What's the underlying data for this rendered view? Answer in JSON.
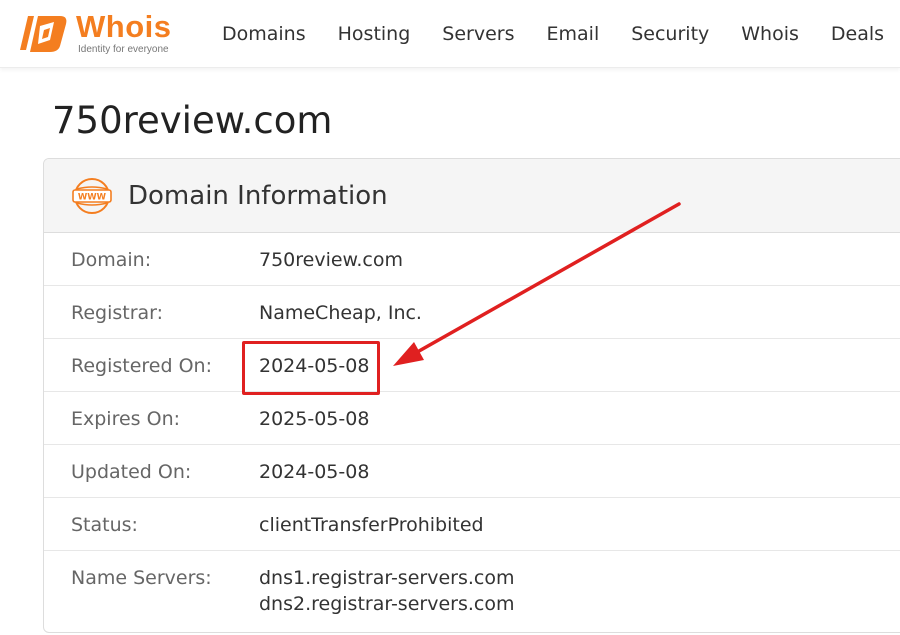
{
  "brand": {
    "name": "Whois",
    "tagline": "Identity for everyone",
    "accent_color": "#f47e20"
  },
  "nav": {
    "items": [
      {
        "label": "Domains"
      },
      {
        "label": "Hosting"
      },
      {
        "label": "Servers"
      },
      {
        "label": "Email"
      },
      {
        "label": "Security"
      },
      {
        "label": "Whois"
      },
      {
        "label": "Deals"
      }
    ]
  },
  "page": {
    "title": "750review.com"
  },
  "domain_info": {
    "icon": "www-globe-icon",
    "icon_text": "WWW",
    "title": "Domain Information",
    "rows": [
      {
        "label": "Domain:",
        "value": "750review.com"
      },
      {
        "label": "Registrar:",
        "value": "NameCheap, Inc."
      },
      {
        "label": "Registered On:",
        "value": "2024-05-08"
      },
      {
        "label": "Expires On:",
        "value": "2025-05-08"
      },
      {
        "label": "Updated On:",
        "value": "2024-05-08"
      },
      {
        "label": "Status:",
        "value": "clientTransferProhibited"
      },
      {
        "label": "Name Servers:",
        "value": "dns1.registrar-servers.com",
        "value2": "dns2.registrar-servers.com"
      }
    ]
  },
  "annotation": {
    "color": "#e02020",
    "target": "Registered On"
  }
}
